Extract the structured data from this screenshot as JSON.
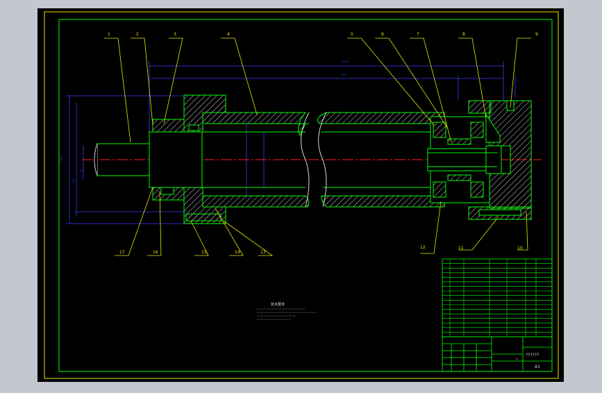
{
  "drawing": {
    "callouts": [
      "1",
      "2",
      "3",
      "4",
      "5",
      "6",
      "7",
      "8",
      "9",
      "10",
      "11",
      "12",
      "13",
      "14",
      "15",
      "16",
      "17"
    ],
    "notes_title": "技术要求",
    "title_block": {
      "name": "??????",
      "sheet": "A1",
      "scale": "1:1"
    }
  },
  "colors": {
    "viewport_bg": "#c3c7cf",
    "drawing_bg": "#000000",
    "frame": "#e8e800",
    "part": "#00ff00",
    "hatch": "#e0e0e0",
    "dimension": "#3a3aff",
    "centerline": "#ff2020",
    "leader": "#e8e800"
  }
}
